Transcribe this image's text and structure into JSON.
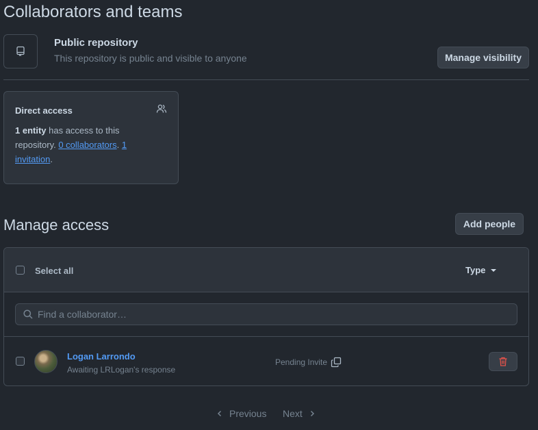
{
  "page": {
    "title": "Collaborators and teams"
  },
  "visibility": {
    "title": "Public repository",
    "description": "This repository is public and visible to anyone",
    "button_label": "Manage visibility"
  },
  "direct_access": {
    "title": "Direct access",
    "entity_count": "1 entity",
    "text_mid": " has access to this repository. ",
    "collaborators_link": "0 collaborators",
    "separator": ". ",
    "invitation_link": "1 invitation",
    "end": "."
  },
  "manage_access": {
    "title": "Manage access",
    "add_button_label": "Add people",
    "select_all_label": "Select all",
    "type_filter_label": "Type",
    "search_placeholder": "Find a collaborator…",
    "members": [
      {
        "name": "Logan Larrondo",
        "status": "Awaiting LRLogan's response",
        "invite_state": "Pending Invite"
      }
    ]
  },
  "pagination": {
    "previous": "Previous",
    "next": "Next"
  },
  "colors": {
    "background": "#22272e",
    "link": "#539bf5",
    "danger": "#e5534b",
    "border": "#444c56"
  }
}
